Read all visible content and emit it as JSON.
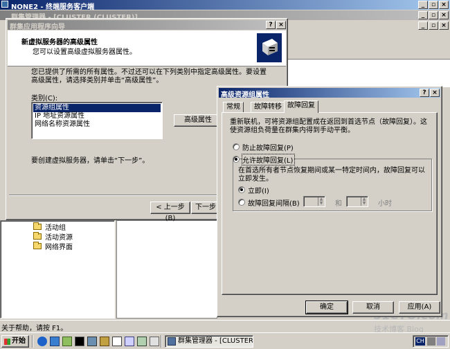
{
  "rdp": {
    "title": "NONE2 - 终端服务客户端"
  },
  "cluster_admin": {
    "title": "群集管理器 - [CLUSTER (CLUSTER)]"
  },
  "tree": {
    "items": [
      "活动组",
      "活动资源",
      "网络界面"
    ]
  },
  "status_bar": {
    "text": "关于帮助，请按 F1。"
  },
  "wizard": {
    "title": "群集应用程序向导",
    "heading": "新虚拟服务器的高级属性",
    "subheading": "您可以设置高级虚拟服务器属性。",
    "description": "您已提供了所需的所有属性。不过还可以在下列类别中指定高级属性。要设置高级属性，请选择类别并单击“高级属性”。",
    "category_label": "类别(C):",
    "categories": [
      "资源组属性",
      "IP 地址资源属性",
      "网络名称资源属性"
    ],
    "advanced_button": "高级属性",
    "footer_text": "要创建虚拟服务器，请单击“下一步”。",
    "back_button": "< 上一步(B)",
    "next_button": "下一步"
  },
  "adv_dialog": {
    "title": "高级资源组属性",
    "tabs": [
      "常规",
      "故障转移",
      "故障回复"
    ],
    "description": "重新联机，可将资源组配置成在返回到首选节点（故障回复）。这使资源组负荷量在群集内得到手动平衡。",
    "prevent_label": "防止故障回复(P)",
    "allow_label": "允许故障回复(L)",
    "group_text": "在首选所有者节点恢复期间或某一特定时间内，故障回复可以立即发生。",
    "immediate_label": "立即(I)",
    "interval_label": "故障回复间隔(B)",
    "and_label": "和",
    "hours_label": "小时",
    "ok_button": "确定",
    "cancel_button": "取消",
    "apply_button": "应用(A)"
  },
  "taskbar": {
    "start_label": "开始",
    "task_label": "群集管理器 - [CLUSTER ...",
    "lang_indicator": "CH"
  },
  "watermark": {
    "line1": "51CTO.com",
    "line2": "技术博客 Blog"
  }
}
